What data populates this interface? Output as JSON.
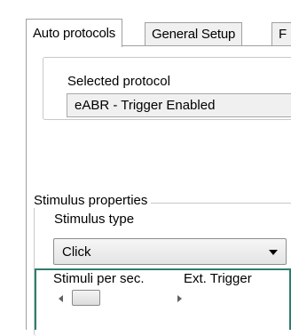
{
  "tabs": [
    {
      "label": "Auto protocols",
      "active": true
    },
    {
      "label": "General Setup",
      "active": false
    },
    {
      "label": "F",
      "active": false
    }
  ],
  "selected_protocol": {
    "label": "Selected protocol",
    "value": "eABR - Trigger Enabled"
  },
  "stimulus_properties": {
    "legend": "Stimulus properties",
    "stimulus_type_label": "Stimulus type",
    "stimulus_type_value": "Click",
    "stimuli_per_sec_label": "Stimuli per sec.",
    "ext_trigger_label": "Ext. Trigger"
  },
  "colors": {
    "highlight_border": "#2e7d6e"
  }
}
